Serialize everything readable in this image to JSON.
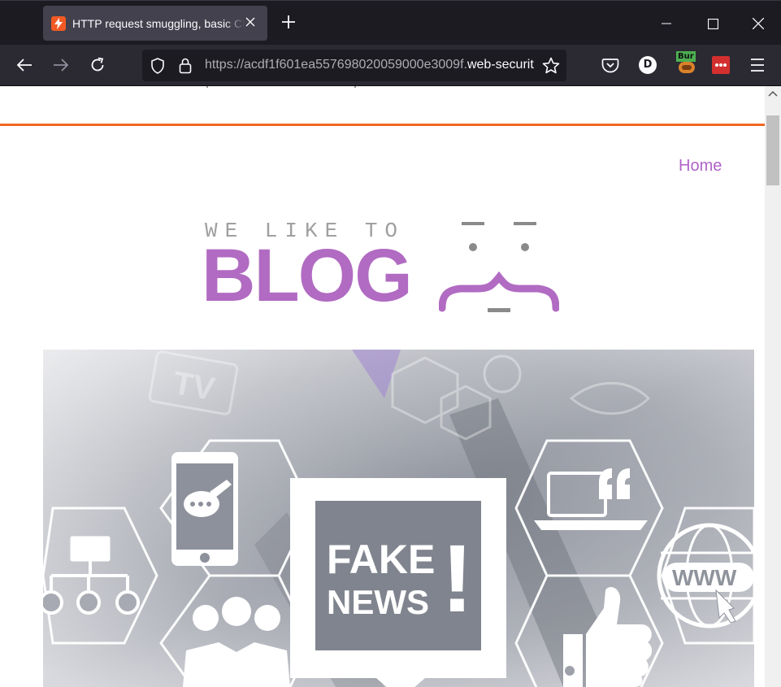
{
  "browser": {
    "tab_title": "HTTP request smuggling, basic CL.TE vulnerability",
    "url_prefix": "https://acdf1f601ea557698020059000e3009f.",
    "url_host": "web-security-academy.net",
    "extension_badge": "Bur",
    "account_initial": "D"
  },
  "icons": {
    "favicon": "lightning-bolt-icon",
    "back": "arrow-left-icon",
    "forward": "arrow-right-icon",
    "reload": "reload-icon",
    "tracking": "shield-icon",
    "lock": "lock-icon",
    "bookmark": "star-icon",
    "pocket": "pocket-icon",
    "menu": "hamburger-icon"
  },
  "page": {
    "nav_home": "Home",
    "logo_top": "WE LIKE TO",
    "logo_main": "BLOG",
    "hero_text_line1": "FAKE",
    "hero_text_line2": "NEWS",
    "hero_text_bang": "!",
    "hero_tv": "TV",
    "hero_www": "WWW"
  },
  "colors": {
    "accent_purple": "#b063c8",
    "rule_orange": "#f26822",
    "chrome_dark": "#1c1b22",
    "toolbar": "#2b2a33"
  }
}
